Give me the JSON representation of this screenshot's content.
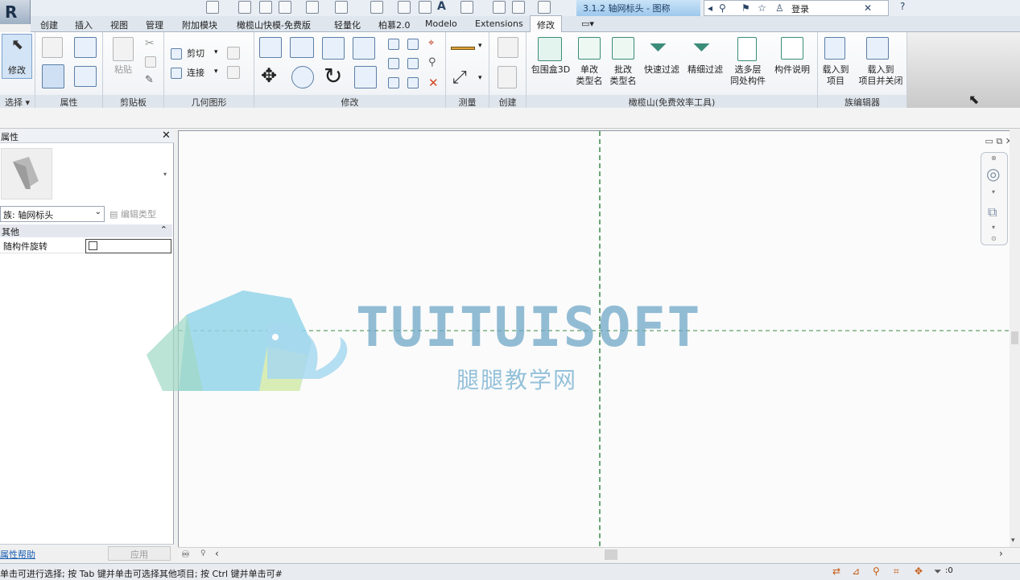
{
  "title_bar": {
    "app_button": "R",
    "document_title": "3.1.2 轴网标头 - 图称",
    "login": "登录",
    "help": "?"
  },
  "tabs": [
    "创建",
    "插入",
    "视图",
    "管理",
    "附加模块",
    "橄榄山快模-免费版",
    "轻量化",
    "柏慕2.0",
    "Modelo",
    "Extensions",
    "修改"
  ],
  "active_tab": "修改",
  "ribbon": {
    "select": {
      "button": "修改",
      "title": "选择"
    },
    "properties": {
      "title": "属性"
    },
    "clipboard": {
      "paste": "粘贴",
      "title": "剪贴板"
    },
    "geometry": {
      "cut": "剪切",
      "join": "连接",
      "title": "几何图形"
    },
    "modify": {
      "title": "修改"
    },
    "measure": {
      "title": "测量"
    },
    "create": {
      "title": "创建"
    },
    "olive": {
      "title": "橄榄山(免费效率工具)",
      "items": [
        "包围盒3D",
        "单改\n类型名",
        "批改\n类型名",
        "快速过滤",
        "精细过滤",
        "选多层\n同处构件",
        "构件说明"
      ]
    },
    "family_editor": {
      "title": "族编辑器",
      "items": [
        "载入到\n项目",
        "载入到\n项目并关闭"
      ]
    }
  },
  "properties": {
    "title": "属性",
    "family_label": "族: 轴网标头",
    "edit_type": "编辑类型",
    "section": "其他",
    "param_label": "随构件旋转",
    "help_link": "属性帮助",
    "apply": "应用"
  },
  "watermark": {
    "brand": "TUITUISOFT",
    "subtitle": "腿腿教学网"
  },
  "status": {
    "text": "单击可进行选择; 按 Tab 键并单击可选择其他项目; 按 Ctrl 键并单击可#",
    "filter_count": ":0"
  },
  "colors": {
    "accent": "#3b77b8",
    "grid_line": "#3a8a4a",
    "watermark_blue": "#6fa8c8"
  }
}
